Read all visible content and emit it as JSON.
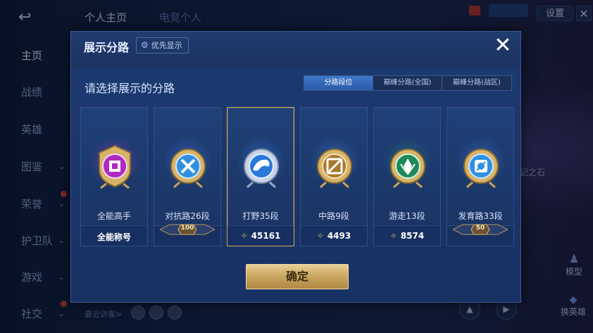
{
  "nav": {
    "items": [
      {
        "label": "主页",
        "active": true
      },
      {
        "label": "战绩"
      },
      {
        "label": "英雄"
      },
      {
        "label": "图鉴",
        "chevron": true
      },
      {
        "label": "荣誉",
        "chevron": true,
        "dot": true
      },
      {
        "label": "护卫队",
        "chevron": true
      },
      {
        "label": "游戏",
        "chevron": true
      },
      {
        "label": "社交",
        "chevron": true,
        "dot": true
      }
    ],
    "back_icon": "back-arrow-icon"
  },
  "top": {
    "tab_profile": "个人主页",
    "tab_second": "电竞个人",
    "settings_label": "设置",
    "close_icon": "close-icon"
  },
  "right": {
    "side_text": "记之石",
    "model_label": "模型",
    "swap_label": "换英雄"
  },
  "bottom": {
    "visitors_label": "最近访客>"
  },
  "modal": {
    "title": "展示分路",
    "priority_label": "优先显示",
    "subtitle": "请选择展示的分路",
    "tabs": [
      {
        "label": "分路段位",
        "active": true
      },
      {
        "label": "巅峰分路(全国)"
      },
      {
        "label": "巅峰分路(战区)"
      }
    ],
    "cards": [
      {
        "label": "全能高手",
        "footer": "全能称号",
        "color": "#b02ac0"
      },
      {
        "label": "对抗路26段",
        "ribbon": "100",
        "color": "#2f8fe0"
      },
      {
        "label": "打野35段",
        "score": "45161",
        "selected": true,
        "color": "#2a78d8"
      },
      {
        "label": "中路9段",
        "score": "4493",
        "color": "#a8772e"
      },
      {
        "label": "游走13段",
        "score": "8574",
        "color": "#1e8a5a"
      },
      {
        "label": "发育路33段",
        "ribbon": "50",
        "color": "#2f8fe0"
      }
    ],
    "confirm_label": "确定"
  }
}
